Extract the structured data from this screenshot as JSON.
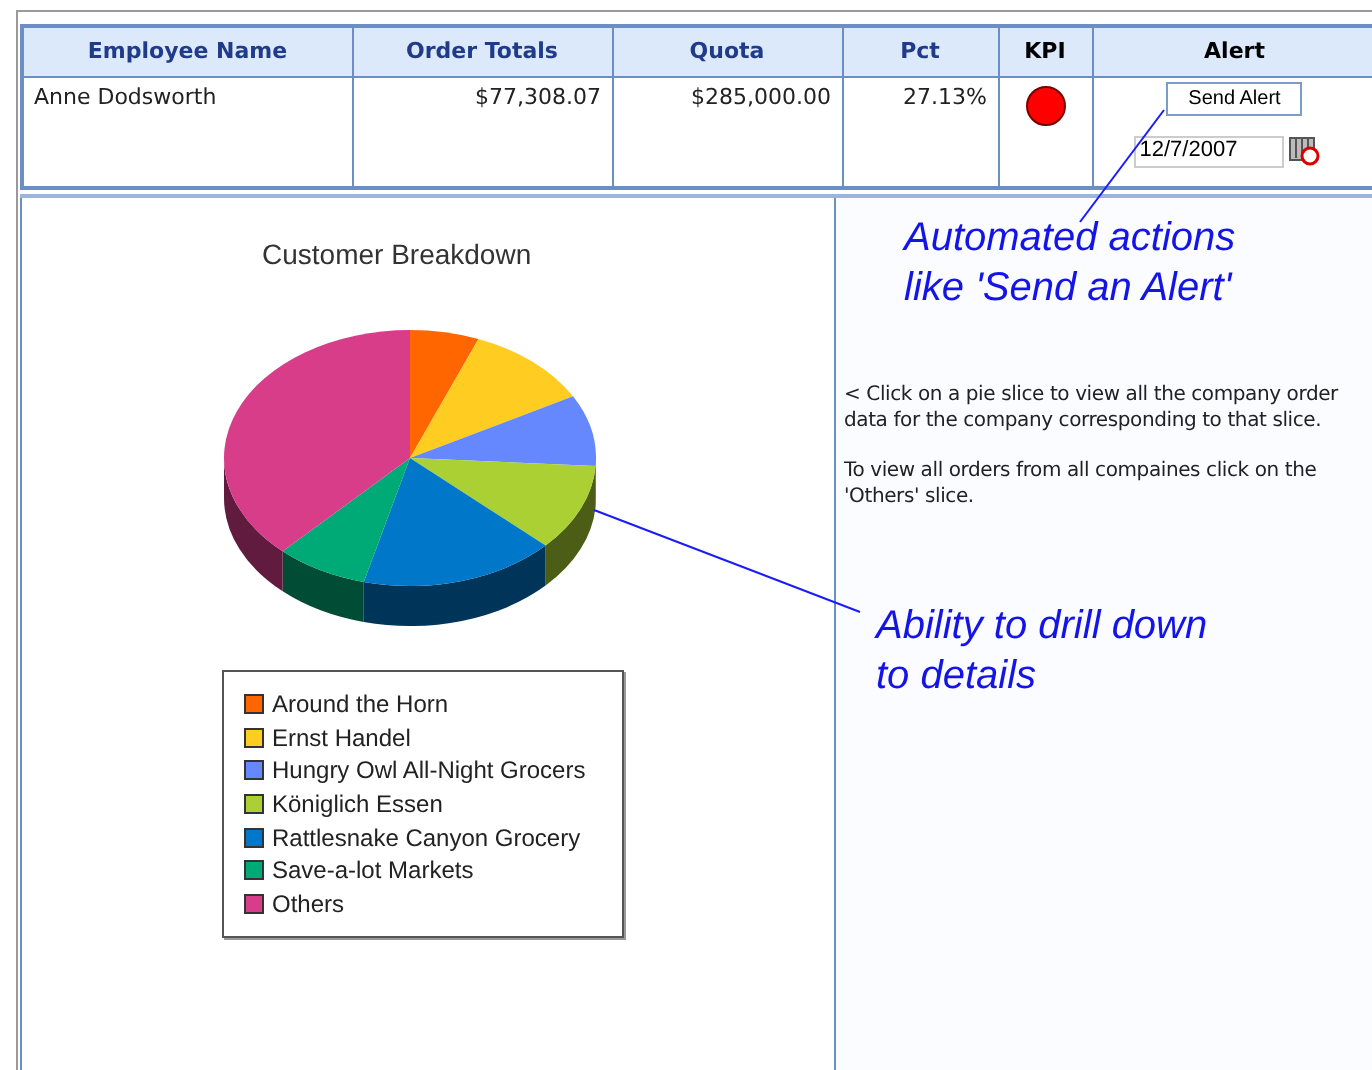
{
  "table": {
    "columns": [
      "Employee Name",
      "Order Totals",
      "Quota",
      "Pct",
      "KPI",
      "Alert"
    ],
    "rows": [
      {
        "employee": "Anne Dodsworth",
        "order_totals": "$77,308.07",
        "quota": "$285,000.00",
        "pct": "27.13%",
        "kpi_alert": true,
        "alert_button": "Send Alert",
        "alert_date": "12/7/2007"
      }
    ]
  },
  "chart": {
    "title": "Customer Breakdown",
    "legend": [
      {
        "label": "Around the Horn",
        "color": "#ff6600"
      },
      {
        "label": "Ernst Handel",
        "color": "#ffcc22"
      },
      {
        "label": "Hungry Owl All-Night Grocers",
        "color": "#6688ff"
      },
      {
        "label": "Königlich Essen",
        "color": "#aad033"
      },
      {
        "label": "Rattlesnake Canyon Grocery",
        "color": "#0077c8"
      },
      {
        "label": "Save-a-lot Markets",
        "color": "#00aa77"
      },
      {
        "label": "Others",
        "color": "#d83d8a"
      }
    ]
  },
  "info": {
    "paragraphs": [
      "< Click on a pie slice to view all the company order data for the company corresponding to that slice.",
      "To view all orders from all compaines click on the 'Others' slice."
    ]
  },
  "callouts": [
    "Automated actions like 'Send an Alert'",
    "Ability to drill down to details"
  ]
}
